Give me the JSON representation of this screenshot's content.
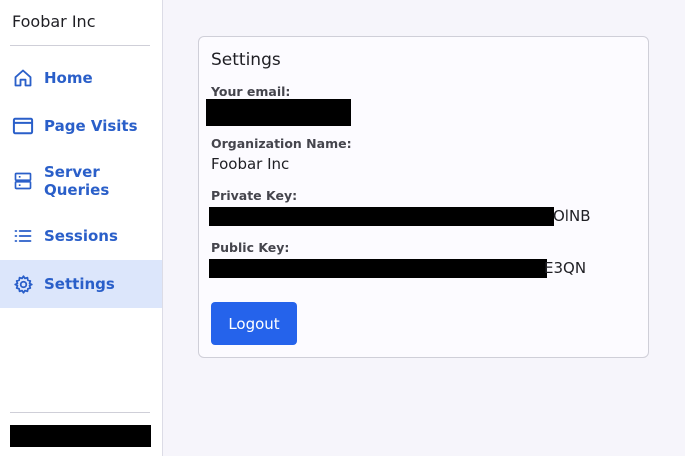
{
  "sidebar": {
    "org_name": "Foobar Inc",
    "items": [
      {
        "label": "Home",
        "icon": "home-icon"
      },
      {
        "label": "Page Visits",
        "icon": "window-icon"
      },
      {
        "label": "Server\nQueries",
        "icon": "server-icon"
      },
      {
        "label": "Sessions",
        "icon": "list-icon"
      },
      {
        "label": "Settings",
        "icon": "gear-icon",
        "active": true
      }
    ]
  },
  "settings": {
    "title": "Settings",
    "email_label": "Your email:",
    "org_label": "Organization Name:",
    "org_value": "Foobar Inc",
    "private_key_label": "Private Key:",
    "private_key_visible_tail": "OlNB",
    "public_key_label": "Public Key:",
    "public_key_visible_tail": "E3QN",
    "logout_label": "Logout"
  },
  "colors": {
    "accent": "#2563eb",
    "nav_text": "#2a5fc9",
    "active_bg": "#dce6fb"
  }
}
